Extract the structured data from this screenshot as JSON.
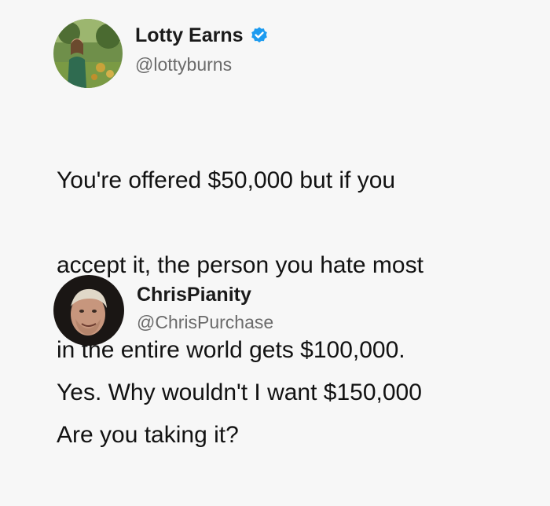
{
  "tweet1": {
    "name": "Lotty Earns",
    "handle": "@lottyburns",
    "verified": true,
    "avatar_icon": "profile-photo-outdoor",
    "text_lines": [
      "You're offered $50,000 but if you",
      "accept it, the person you hate most",
      "in the entire world gets $100,000.",
      "Are you taking it?"
    ]
  },
  "tweet2": {
    "name": "ChrisPianity",
    "handle": "@ChrisPurchase",
    "verified": false,
    "avatar_icon": "profile-photo-face",
    "text": "Yes. Why wouldn't I want $150,000"
  },
  "colors": {
    "background": "#f7f7f7",
    "verified_blue": "#1d9bf0",
    "handle_gray": "#6b6b6b",
    "text": "#121212"
  }
}
